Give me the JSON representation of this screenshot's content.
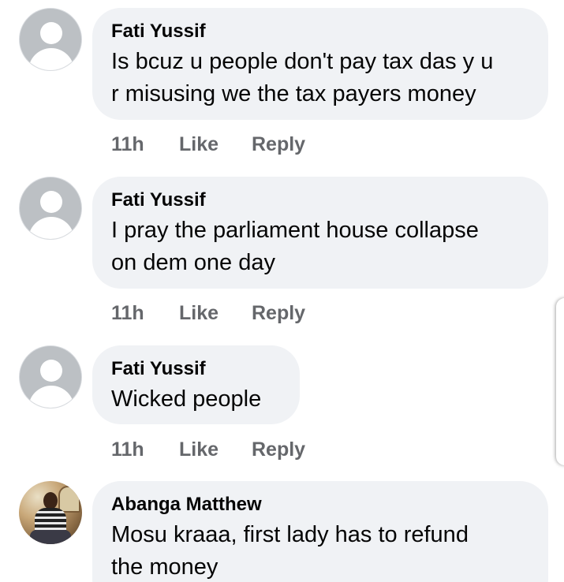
{
  "comments": [
    {
      "author": "Fati Yussif",
      "text_lines": [
        "Is bcuz u people don't pay tax das y u",
        "r misusing we the tax payers money"
      ],
      "time": "11h",
      "like_label": "Like",
      "reply_label": "Reply",
      "avatar": "default-profile-icon"
    },
    {
      "author": "Fati Yussif",
      "text_lines": [
        "I pray the parliament house collapse",
        "on dem one day"
      ],
      "time": "11h",
      "like_label": "Like",
      "reply_label": "Reply",
      "avatar": "default-profile-icon"
    },
    {
      "author": "Fati Yussif",
      "text_lines": [
        "Wicked people"
      ],
      "time": "11h",
      "like_label": "Like",
      "reply_label": "Reply",
      "avatar": "default-profile-icon"
    },
    {
      "author": "Abanga Matthew",
      "text_lines": [
        "Mosu kraaa, first lady has to refund",
        "the money"
      ],
      "avatar": "profile-photo"
    }
  ],
  "colors": {
    "bubble_background": "#f0f2f5",
    "secondary_text": "#65676b",
    "primary_text": "#050505",
    "default_avatar": "#bcc0c4"
  }
}
